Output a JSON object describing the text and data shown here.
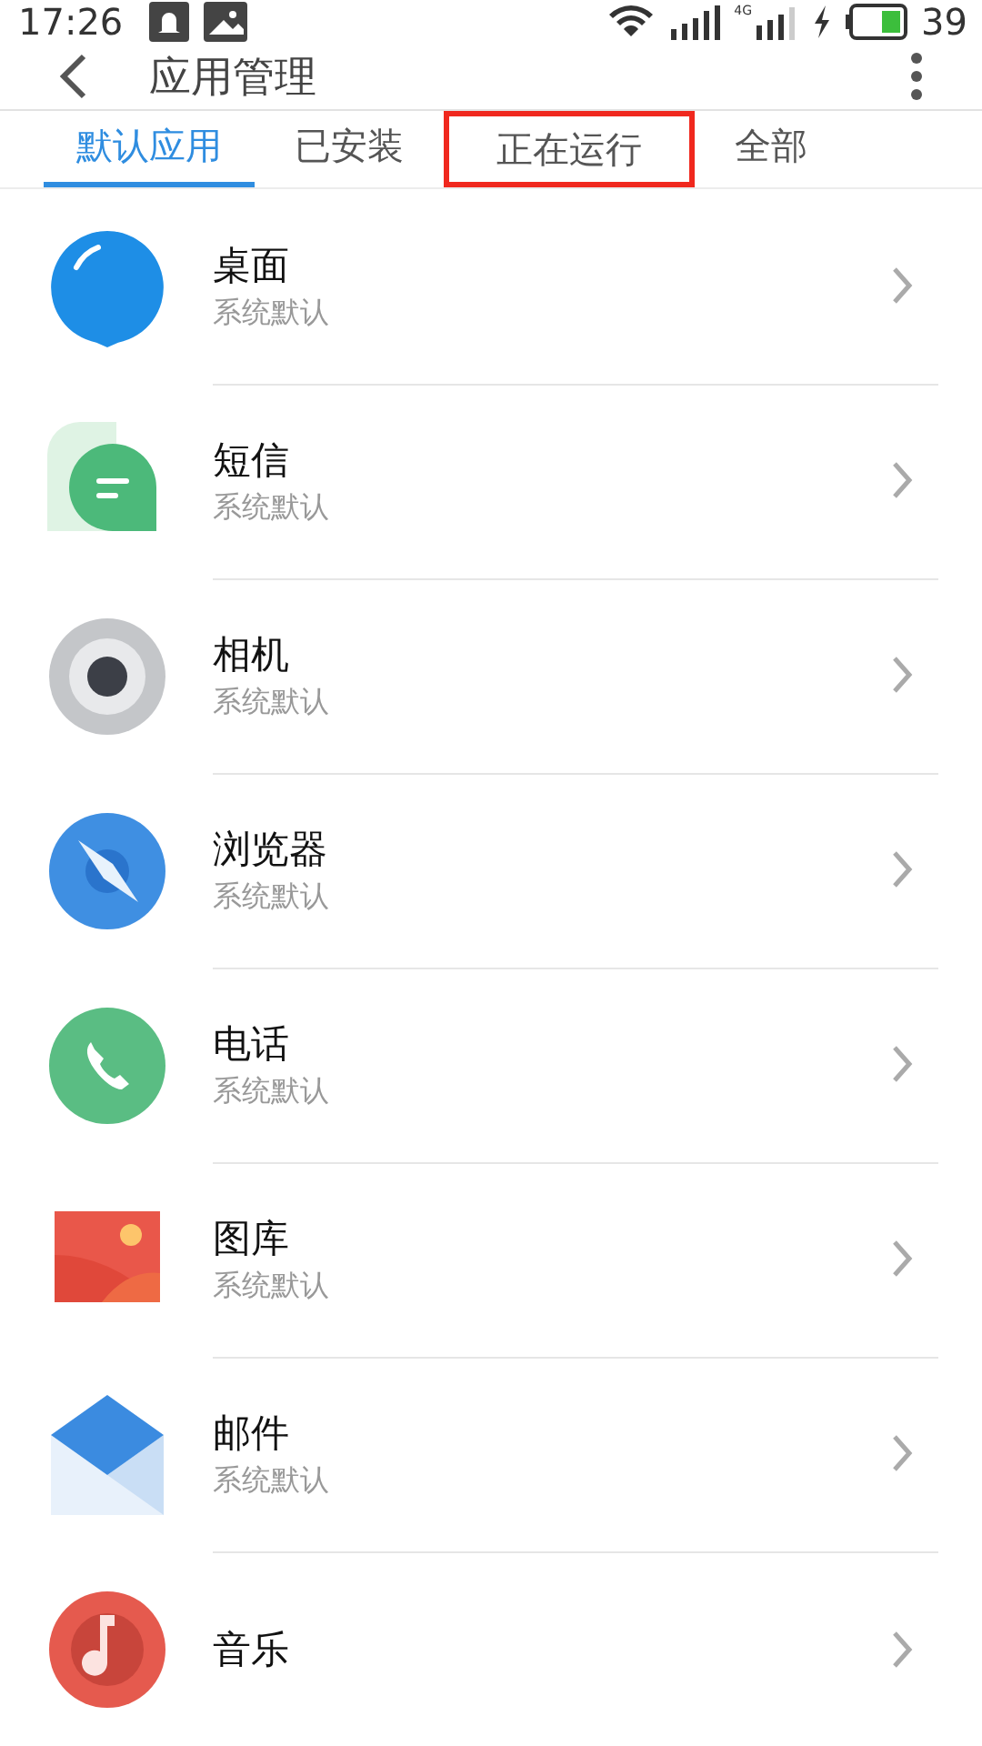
{
  "status_bar": {
    "time": "17:26",
    "network_label": "4G",
    "battery": "39"
  },
  "header": {
    "title": "应用管理"
  },
  "tabs": [
    {
      "label": "默认应用",
      "selected": true,
      "highlighted": false
    },
    {
      "label": "已安装",
      "selected": false,
      "highlighted": false
    },
    {
      "label": "正在运行",
      "selected": false,
      "highlighted": true
    },
    {
      "label": "全部",
      "selected": false,
      "highlighted": false
    }
  ],
  "apps": [
    {
      "kind": "home",
      "name": "桌面",
      "subtitle": "系统默认"
    },
    {
      "kind": "sms",
      "name": "短信",
      "subtitle": "系统默认"
    },
    {
      "kind": "camera",
      "name": "相机",
      "subtitle": "系统默认"
    },
    {
      "kind": "browser",
      "name": "浏览器",
      "subtitle": "系统默认"
    },
    {
      "kind": "phone",
      "name": "电话",
      "subtitle": "系统默认"
    },
    {
      "kind": "gallery",
      "name": "图库",
      "subtitle": "系统默认"
    },
    {
      "kind": "mail",
      "name": "邮件",
      "subtitle": "系统默认"
    },
    {
      "kind": "music",
      "name": "音乐"
    }
  ]
}
